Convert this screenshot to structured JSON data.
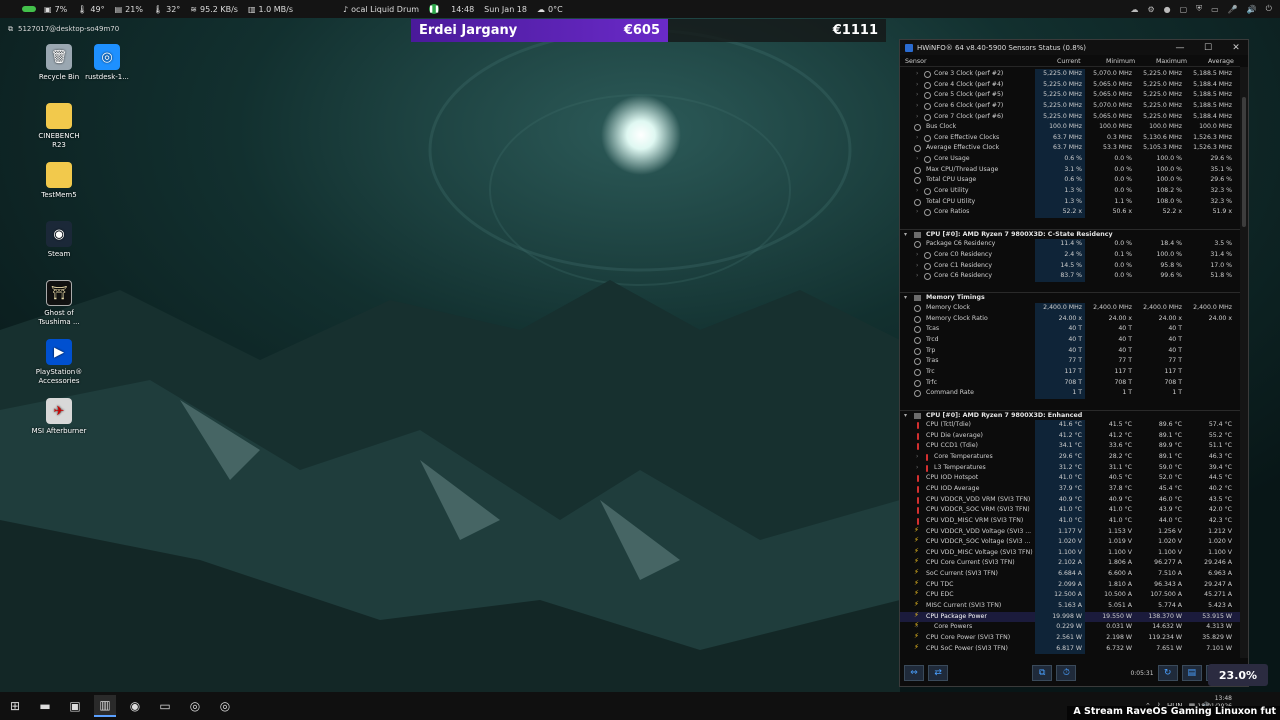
{
  "topbar": {
    "cpu_pct": "7%",
    "cpu_temp": "49°",
    "gpu_pct": "21%",
    "gpu_temp": "32°",
    "net_speed": "95.2 KB/s",
    "disk_speed": "1.0 MB/s",
    "media": "ocal Liquid Drum",
    "time": "14:48",
    "date": "Sun Jan 18",
    "weather": "0°C"
  },
  "session": {
    "label": "5127017@desktop-so49m70"
  },
  "overlay": {
    "name": "Erdei Jargany",
    "amount": "€605",
    "total": "€1111"
  },
  "desktop_icons": [
    {
      "label": "Recycle Bin",
      "icon": "recycle-bin-icon"
    },
    {
      "label": "rustdesk-1...",
      "icon": "rustdesk-icon"
    },
    {
      "label": "CINEBENCH R23",
      "icon": "folder-icon"
    },
    {
      "label": "TestMem5",
      "icon": "folder-icon"
    },
    {
      "label": "Steam",
      "icon": "steam-icon"
    },
    {
      "label": "Ghost of Tsushima ...",
      "icon": "ghost-of-tsushima-icon"
    },
    {
      "label": "PlayStation® Accessories",
      "icon": "playstation-icon"
    },
    {
      "label": "MSI Afterburner",
      "icon": "msi-afterburner-icon"
    }
  ],
  "hwinfo": {
    "title": "HWiNFO® 64 v8.40-5900 Sensors Status (0.8%)",
    "columns": {
      "sensor": "Sensor",
      "current": "Current",
      "minimum": "Minimum",
      "maximum": "Maximum",
      "average": "Average"
    },
    "rows_top": [
      {
        "name": "Core 3 Clock (perf #2)",
        "cur": "5,225.0 MHz",
        "min": "5,070.0 MHz",
        "max": "5,225.0 MHz",
        "avg": "5,188.5 MHz",
        "sub": true
      },
      {
        "name": "Core 4 Clock (perf #4)",
        "cur": "5,225.0 MHz",
        "min": "5,065.0 MHz",
        "max": "5,225.0 MHz",
        "avg": "5,188.4 MHz",
        "sub": true
      },
      {
        "name": "Core 5 Clock (perf #5)",
        "cur": "5,225.0 MHz",
        "min": "5,065.0 MHz",
        "max": "5,225.0 MHz",
        "avg": "5,188.5 MHz",
        "sub": true
      },
      {
        "name": "Core 6 Clock (perf #7)",
        "cur": "5,225.0 MHz",
        "min": "5,070.0 MHz",
        "max": "5,225.0 MHz",
        "avg": "5,188.5 MHz",
        "sub": true
      },
      {
        "name": "Core 7 Clock (perf #6)",
        "cur": "5,225.0 MHz",
        "min": "5,065.0 MHz",
        "max": "5,225.0 MHz",
        "avg": "5,188.4 MHz",
        "sub": true
      },
      {
        "name": "Bus Clock",
        "cur": "100.0 MHz",
        "min": "100.0 MHz",
        "max": "100.0 MHz",
        "avg": "100.0 MHz"
      },
      {
        "name": "Core Effective Clocks",
        "cur": "63.7 MHz",
        "min": "0.3 MHz",
        "max": "5,130.6 MHz",
        "avg": "1,526.3 MHz",
        "sub": true
      },
      {
        "name": "Average Effective Clock",
        "cur": "63.7 MHz",
        "min": "53.3 MHz",
        "max": "5,105.3 MHz",
        "avg": "1,526.3 MHz"
      },
      {
        "name": "Core Usage",
        "cur": "0.6 %",
        "min": "0.0 %",
        "max": "100.0 %",
        "avg": "29.6 %",
        "sub": true
      },
      {
        "name": "Max CPU/Thread Usage",
        "cur": "3.1 %",
        "min": "0.0 %",
        "max": "100.0 %",
        "avg": "35.1 %"
      },
      {
        "name": "Total CPU Usage",
        "cur": "0.6 %",
        "min": "0.0 %",
        "max": "100.0 %",
        "avg": "29.6 %"
      },
      {
        "name": "Core Utility",
        "cur": "1.3 %",
        "min": "0.0 %",
        "max": "108.2 %",
        "avg": "32.3 %",
        "sub": true
      },
      {
        "name": "Total CPU Utility",
        "cur": "1.3 %",
        "min": "1.1 %",
        "max": "108.0 %",
        "avg": "32.3 %"
      },
      {
        "name": "Core Ratios",
        "cur": "52.2 x",
        "min": "50.6 x",
        "max": "52.2 x",
        "avg": "51.9 x",
        "sub": true
      }
    ],
    "group_cstate": "CPU [#0]: AMD Ryzen 7 9800X3D: C-State Residency",
    "rows_cstate": [
      {
        "name": "Package C6 Residency",
        "cur": "11.4 %",
        "min": "0.0 %",
        "max": "18.4 %",
        "avg": "3.5 %"
      },
      {
        "name": "Core C0 Residency",
        "cur": "2.4 %",
        "min": "0.1 %",
        "max": "100.0 %",
        "avg": "31.4 %",
        "sub": true
      },
      {
        "name": "Core C1 Residency",
        "cur": "14.5 %",
        "min": "0.0 %",
        "max": "95.8 %",
        "avg": "17.0 %",
        "sub": true
      },
      {
        "name": "Core C6 Residency",
        "cur": "83.7 %",
        "min": "0.0 %",
        "max": "99.6 %",
        "avg": "51.8 %",
        "sub": true
      }
    ],
    "group_mem": "Memory Timings",
    "rows_mem": [
      {
        "name": "Memory Clock",
        "cur": "2,400.0 MHz",
        "min": "2,400.0 MHz",
        "max": "2,400.0 MHz",
        "avg": "2,400.0 MHz"
      },
      {
        "name": "Memory Clock Ratio",
        "cur": "24.00 x",
        "min": "24.00 x",
        "max": "24.00 x",
        "avg": "24.00 x"
      },
      {
        "name": "Tcas",
        "cur": "40 T",
        "min": "40 T",
        "max": "40 T",
        "avg": ""
      },
      {
        "name": "Trcd",
        "cur": "40 T",
        "min": "40 T",
        "max": "40 T",
        "avg": ""
      },
      {
        "name": "Trp",
        "cur": "40 T",
        "min": "40 T",
        "max": "40 T",
        "avg": ""
      },
      {
        "name": "Tras",
        "cur": "77 T",
        "min": "77 T",
        "max": "77 T",
        "avg": ""
      },
      {
        "name": "Trc",
        "cur": "117 T",
        "min": "117 T",
        "max": "117 T",
        "avg": ""
      },
      {
        "name": "Trfc",
        "cur": "708 T",
        "min": "708 T",
        "max": "708 T",
        "avg": ""
      },
      {
        "name": "Command Rate",
        "cur": "1 T",
        "min": "1 T",
        "max": "1 T",
        "avg": ""
      }
    ],
    "group_enh": "CPU [#0]: AMD Ryzen 7 9800X3D: Enhanced",
    "rows_enh": [
      {
        "name": "CPU (Tctl/Tdie)",
        "cur": "41.6 °C",
        "min": "41.5 °C",
        "max": "89.6 °C",
        "avg": "57.4 °C",
        "kind": "therm"
      },
      {
        "name": "CPU Die (average)",
        "cur": "41.2 °C",
        "min": "41.2 °C",
        "max": "89.1 °C",
        "avg": "55.2 °C",
        "kind": "therm"
      },
      {
        "name": "CPU CCD1 (Tdie)",
        "cur": "34.1 °C",
        "min": "33.6 °C",
        "max": "89.9 °C",
        "avg": "51.1 °C",
        "kind": "therm"
      },
      {
        "name": "Core Temperatures",
        "cur": "29.6 °C",
        "min": "28.2 °C",
        "max": "89.1 °C",
        "avg": "46.3 °C",
        "kind": "therm",
        "sub": true
      },
      {
        "name": "L3 Temperatures",
        "cur": "31.2 °C",
        "min": "31.1 °C",
        "max": "59.0 °C",
        "avg": "39.4 °C",
        "kind": "therm",
        "sub": true
      },
      {
        "name": "CPU IOD Hotspot",
        "cur": "41.0 °C",
        "min": "40.5 °C",
        "max": "52.0 °C",
        "avg": "44.5 °C",
        "kind": "therm"
      },
      {
        "name": "CPU IOD Average",
        "cur": "37.9 °C",
        "min": "37.8 °C",
        "max": "45.4 °C",
        "avg": "40.2 °C",
        "kind": "therm"
      },
      {
        "name": "CPU VDDCR_VDD VRM (SVI3 TFN)",
        "cur": "40.9 °C",
        "min": "40.9 °C",
        "max": "46.0 °C",
        "avg": "43.5 °C",
        "kind": "therm"
      },
      {
        "name": "CPU VDDCR_SOC VRM (SVI3 TFN)",
        "cur": "41.0 °C",
        "min": "41.0 °C",
        "max": "43.9 °C",
        "avg": "42.0 °C",
        "kind": "therm"
      },
      {
        "name": "CPU VDD_MISC VRM (SVI3 TFN)",
        "cur": "41.0 °C",
        "min": "41.0 °C",
        "max": "44.0 °C",
        "avg": "42.3 °C",
        "kind": "therm"
      },
      {
        "name": "CPU VDDCR_VDD Voltage (SVI3 ...",
        "cur": "1.177 V",
        "min": "1.153 V",
        "max": "1.256 V",
        "avg": "1.212 V",
        "kind": "bolt"
      },
      {
        "name": "CPU VDDCR_SOC Voltage (SVI3 ...",
        "cur": "1.020 V",
        "min": "1.019 V",
        "max": "1.020 V",
        "avg": "1.020 V",
        "kind": "bolt"
      },
      {
        "name": "CPU VDD_MISC Voltage (SVI3 TFN)",
        "cur": "1.100 V",
        "min": "1.100 V",
        "max": "1.100 V",
        "avg": "1.100 V",
        "kind": "bolt"
      },
      {
        "name": "CPU Core Current (SVI3 TFN)",
        "cur": "2.102 A",
        "min": "1.806 A",
        "max": "96.277 A",
        "avg": "29.246 A",
        "kind": "bolt"
      },
      {
        "name": "SoC Current (SVI3 TFN)",
        "cur": "6.684 A",
        "min": "6.600 A",
        "max": "7.510 A",
        "avg": "6.963 A",
        "kind": "bolt"
      },
      {
        "name": "CPU TDC",
        "cur": "2.099 A",
        "min": "1.810 A",
        "max": "96.343 A",
        "avg": "29.247 A",
        "kind": "bolt"
      },
      {
        "name": "CPU EDC",
        "cur": "12.500 A",
        "min": "10.500 A",
        "max": "107.500 A",
        "avg": "45.271 A",
        "kind": "bolt"
      },
      {
        "name": "MISC Current (SVI3 TFN)",
        "cur": "5.163 A",
        "min": "5.051 A",
        "max": "5.774 A",
        "avg": "5.423 A",
        "kind": "bolt"
      },
      {
        "name": "CPU Package Power",
        "cur": "19.998 W",
        "min": "19.550 W",
        "max": "138.370 W",
        "avg": "53.915 W",
        "kind": "bolt",
        "hl": true
      },
      {
        "name": "Core Powers",
        "cur": "0.229 W",
        "min": "0.031 W",
        "max": "14.632 W",
        "avg": "4.313 W",
        "kind": "bolt",
        "sub": true
      },
      {
        "name": "CPU Core Power (SVI3 TFN)",
        "cur": "2.561 W",
        "min": "2.198 W",
        "max": "119.234 W",
        "avg": "35.829 W",
        "kind": "bolt"
      },
      {
        "name": "CPU SoC Power (SVI3 TFN)",
        "cur": "6.817 W",
        "min": "6.732 W",
        "max": "7.651 W",
        "avg": "7.101 W",
        "kind": "bolt"
      }
    ],
    "footer_time": "0:05:31",
    "usage_badge": "23.0%"
  },
  "taskbar": {
    "lang": "HUN",
    "clock_time": "13:48",
    "clock_date": "18/01/2026"
  },
  "ticker": "A Stream RaveOS Gaming Linuxon fut",
  "colors": {
    "overlay": "#5a24b4",
    "accent": "#5aa0ff",
    "highlight_row": "#1b1b3c"
  }
}
